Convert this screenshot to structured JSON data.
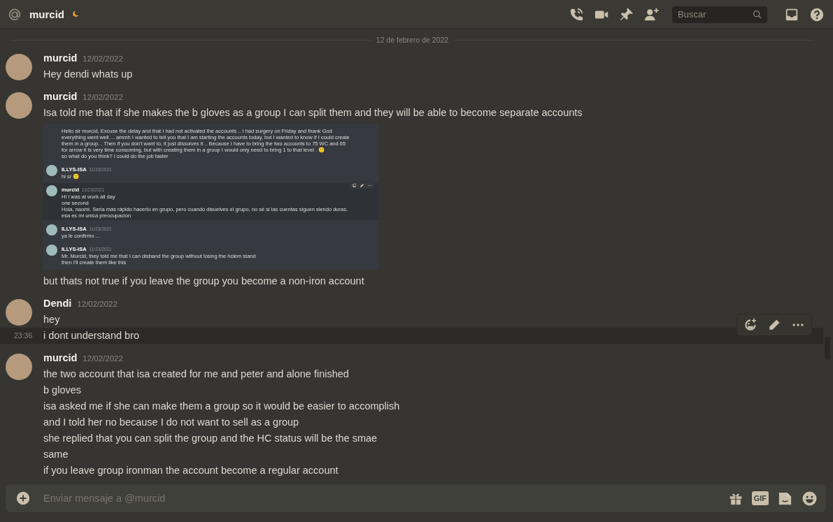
{
  "header": {
    "channel": "murcid",
    "idle": true,
    "search": {
      "placeholder": "Buscar"
    }
  },
  "date_divider": "12 de febrero de 2022",
  "messages": [
    {
      "author": "murcid",
      "timestamp": "12/02/2022",
      "content": [
        {
          "kind": "text",
          "text": "Hey dendi whats up"
        }
      ]
    },
    {
      "author": "murcid",
      "timestamp": "12/02/2022",
      "content": [
        {
          "kind": "text",
          "text": "Isa told me that if she makes the b gloves as a group I can split them and they will be able to become separate accounts"
        },
        {
          "kind": "image",
          "messages": [
            {
              "kind": "continued",
              "hovered": false,
              "lines": [
                "Hello sir murcid, Excuse the delay and that I had not activated the accounts .. I had surgery on Friday and thank God",
                "everything went well ... ammh I wanted to tell you that I am starting the accounts today, but I wanted to know if I could create",
                "them in a group. . Then if you don't want to, it just dissolves it .. Because I have to bring the two accounts to 75 WC and 65",
                "for arrow it is very time consuming, but with creating them in a group I would only need to bring 1 to that level . 🙂",
                "so what do you think? I could do the job faster"
              ]
            },
            {
              "kind": "full",
              "author": "ILLYS-ISA",
              "timestamp": "11/23/2021",
              "hovered": false,
              "lines": [
                "hi sr 🙂"
              ]
            },
            {
              "kind": "full",
              "author": "murcid",
              "timestamp": "11/23/2021",
              "hovered": true,
              "lines": [
                "Hi I was at work all day",
                "one second",
                "Hola, naomi. Seria más rápido hacerlo en grupo, pero cuando disuelves el grupo, no sé si las cuentas siguen siendo duras.",
                "esa es mi unica preocupacion"
              ]
            },
            {
              "kind": "full",
              "author": "ILLYS-ISA",
              "timestamp": "11/23/2021",
              "hovered": false,
              "lines": [
                "ya le confirmo ..."
              ]
            },
            {
              "kind": "full",
              "author": "ILLYS-ISA",
              "timestamp": "11/23/2021",
              "hovered": false,
              "lines": [
                "Mr. Murcid, they told me that I can disband the group without losing the hciem stand",
                "then I'll create them like this"
              ]
            }
          ]
        },
        {
          "kind": "text",
          "text": "but thats not true if you leave the group you become a non-iron account"
        }
      ]
    },
    {
      "author": "Dendi",
      "timestamp": "12/02/2022",
      "content": [
        {
          "kind": "text",
          "text": "hey"
        },
        {
          "kind": "hovered_text",
          "text": "i dont understand bro",
          "time": "23:36"
        }
      ]
    },
    {
      "author": "murcid",
      "timestamp": "12/02/2022",
      "content": [
        {
          "kind": "text",
          "text": "the two account that isa created for me and peter and alone finished"
        },
        {
          "kind": "text",
          "text": "b gloves"
        },
        {
          "kind": "text",
          "text": "isa asked me if she can make them a group so it would be easier to accomplish"
        },
        {
          "kind": "text",
          "text": "and I told her no because I do not want to sell as a group"
        },
        {
          "kind": "text",
          "text": "she replied that you can split the group and the HC status will be the smae"
        },
        {
          "kind": "text",
          "text": "same"
        },
        {
          "kind": "text",
          "text": "if you leave group ironman the account become a regular account"
        }
      ]
    }
  ],
  "composer": {
    "placeholder": "Enviar mensaje a @murcid",
    "gif_label": "GIF"
  }
}
